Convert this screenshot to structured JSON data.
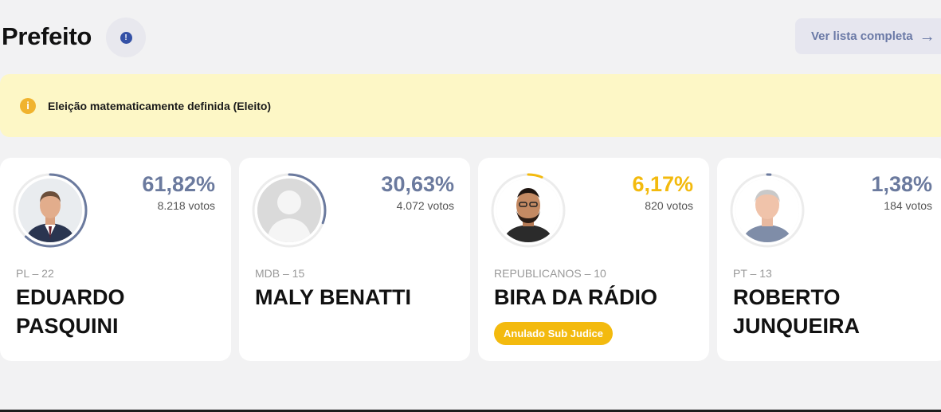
{
  "header": {
    "title": "Prefeito",
    "info_icon": "!",
    "ver_lista_label": "Ver lista completa",
    "ver_lista_icon": "→"
  },
  "alert": {
    "icon": "i",
    "text": "Eleição matematicamente definida (Eleito)"
  },
  "colors": {
    "accent": "#6b7a9e",
    "highlight": "#f3ba0e",
    "alert_bg": "#fdf7c6"
  },
  "candidates": [
    {
      "percent": "61,82%",
      "share": 0.6182,
      "votes": "8.218 votos",
      "party": "PL – 22",
      "name": "EDUARDO PASQUINI",
      "badge": "",
      "color": "#6b7a9e",
      "photo": "photo-man-suit"
    },
    {
      "percent": "30,63%",
      "share": 0.3063,
      "votes": "4.072 votos",
      "party": "MDB – 15",
      "name": "MALY BENATTI",
      "badge": "",
      "color": "#6b7a9e",
      "photo": "placeholder-avatar"
    },
    {
      "percent": "6,17%",
      "share": 0.0617,
      "votes": "820 votos",
      "party": "REPUBLICANOS – 10",
      "name": "BIRA DA RÁDIO",
      "badge": "Anulado Sub Judice",
      "color": "#f3ba0e",
      "photo": "photo-man-bald-beard"
    },
    {
      "percent": "1,38%",
      "share": 0.0138,
      "votes": "184 votos",
      "party": "PT – 13",
      "name": "ROBERTO JUNQUEIRA",
      "badge": "",
      "color": "#6b7a9e",
      "photo": "photo-man-gray-hair"
    }
  ]
}
